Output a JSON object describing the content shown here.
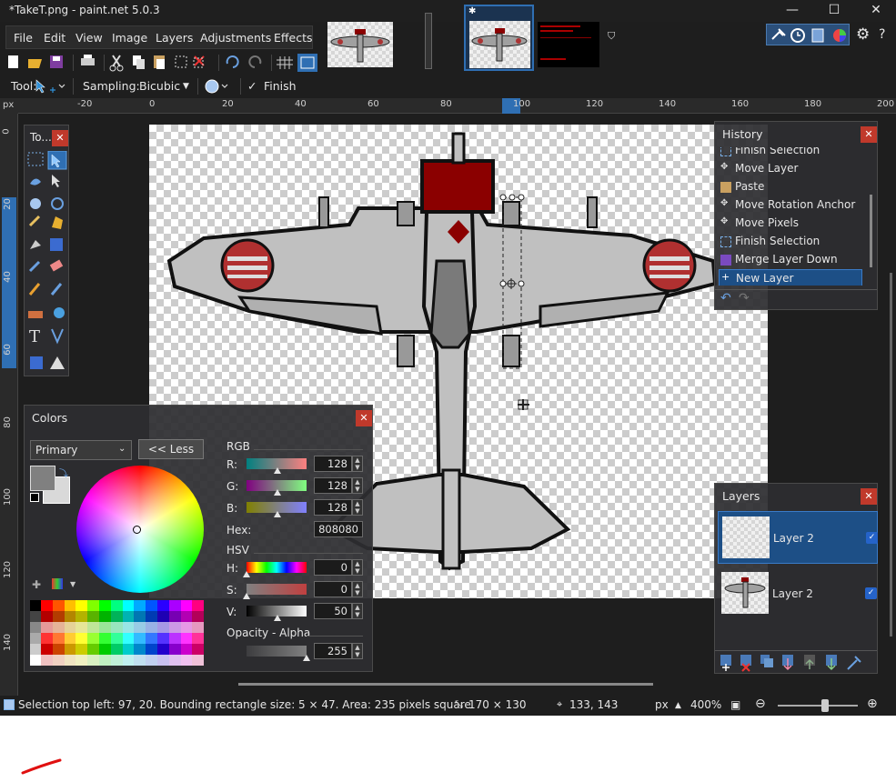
{
  "window": {
    "title": "*TakeT.png - paint.net 5.0.3",
    "minimize": "—",
    "maximize": "☐",
    "close": "✕"
  },
  "menu": [
    "File",
    "Edit",
    "View",
    "Image",
    "Layers",
    "Adjustments",
    "Effects"
  ],
  "toolbar": {
    "tool_label": "Tool:",
    "sampling_label": "Sampling:",
    "sampling_value": "Bicubic",
    "finish_label": "Finish"
  },
  "ruler": {
    "corner": "px",
    "top": [
      "-20",
      "0",
      "20",
      "40",
      "60",
      "80",
      "100",
      "120",
      "140",
      "160",
      "180",
      "200"
    ],
    "left": [
      "0",
      "20",
      "40",
      "60",
      "80",
      "100",
      "120",
      "140"
    ]
  },
  "tools_panel": {
    "title": "To..."
  },
  "history": {
    "title": "History",
    "items": [
      {
        "label": "Finish Selection",
        "icon": "selection-icon"
      },
      {
        "label": "Move Layer",
        "icon": "move-icon"
      },
      {
        "label": "Paste",
        "icon": "paste-icon"
      },
      {
        "label": "Move Rotation Anchor",
        "icon": "move-icon"
      },
      {
        "label": "Move Pixels",
        "icon": "move-icon"
      },
      {
        "label": "Finish Selection",
        "icon": "selection-icon"
      },
      {
        "label": "Merge Layer Down",
        "icon": "merge-icon"
      },
      {
        "label": "New Layer",
        "icon": "new-layer-icon"
      }
    ],
    "selected_index": 7
  },
  "layers": {
    "title": "Layers",
    "items": [
      {
        "name": "Layer 2",
        "visible": true,
        "selected": true
      },
      {
        "name": "Layer 2",
        "visible": true,
        "selected": false
      }
    ]
  },
  "colors": {
    "title": "Colors",
    "mode": "Primary",
    "less_button": "<< Less",
    "rgb_label": "RGB",
    "r_label": "R:",
    "r": "128",
    "g_label": "G:",
    "g": "128",
    "b_label": "B:",
    "b": "128",
    "hex_label": "Hex:",
    "hex": "808080",
    "hsv_label": "HSV",
    "h_label": "H:",
    "h": "0",
    "s_label": "S:",
    "s": "0",
    "v_label": "V:",
    "v": "50",
    "opacity_label": "Opacity - Alpha",
    "alpha": "255",
    "primary_color": "#808080",
    "secondary_color": "#d9d9d9"
  },
  "status": {
    "selection": "Selection top left: 97, 20. Bounding rectangle size: 5 × 47. Area: 235 pixels square",
    "image_size": "170 × 130",
    "cursor": "133, 143",
    "units": "px",
    "zoom": "400%"
  },
  "colors_accent": {
    "accent": "#2f6fb3",
    "close_red": "#c0392b",
    "plane_red": "#8b0000"
  }
}
